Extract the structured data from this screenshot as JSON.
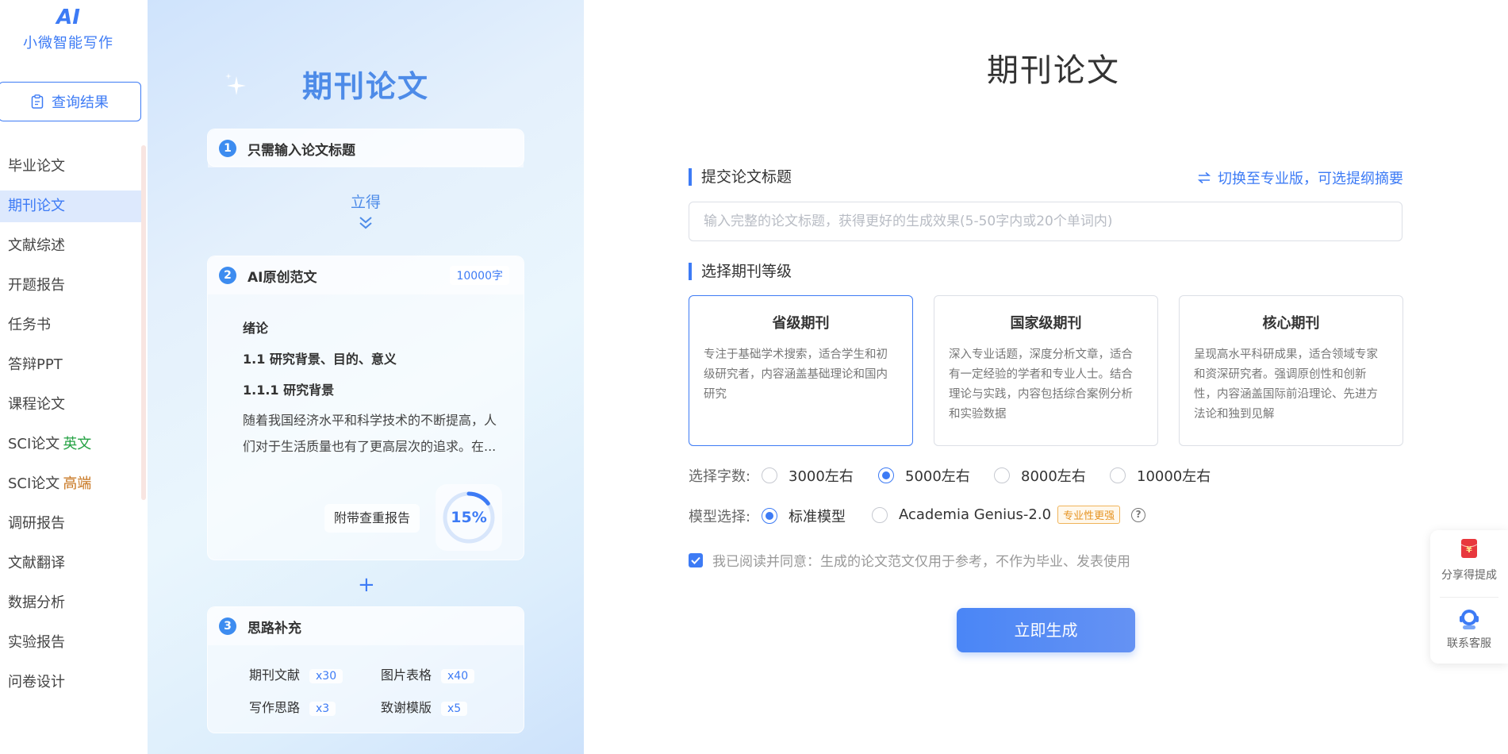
{
  "sidebar": {
    "logo_mark": "AI",
    "logo_text": "小微智能写作",
    "query_button": "查询结果",
    "nav": [
      {
        "label": "毕业论文"
      },
      {
        "label": "期刊论文",
        "active": true
      },
      {
        "label": "文献综述"
      },
      {
        "label": "开题报告"
      },
      {
        "label": "任务书"
      },
      {
        "label": "答辩PPT"
      },
      {
        "label": "课程论文"
      },
      {
        "label": "SCI论文",
        "tag": "英文"
      },
      {
        "label": "SCI论文",
        "tag": "高端"
      },
      {
        "label": "调研报告"
      },
      {
        "label": "文献翻译"
      },
      {
        "label": "数据分析"
      },
      {
        "label": "实验报告"
      },
      {
        "label": "问卷设计"
      }
    ]
  },
  "promo": {
    "title": "期刊论文",
    "step1": {
      "num": "1",
      "title": "只需输入论文标题"
    },
    "arrow_text": "立得",
    "step2": {
      "num": "2",
      "title": "AI原创范文",
      "badge": "10000字",
      "outline": [
        "绪论",
        "1.1 研究背景、目的、意义",
        "1.1.1 研究背景"
      ],
      "paragraph": "随着我国经济水平和科学技术的不断提高，人们对于生活质量也有了更高层次的追求。在...",
      "report_label": "附带查重报告",
      "progress_text": "15%",
      "progress": 0.15
    },
    "plus": "+",
    "step3": {
      "num": "3",
      "title": "思路补充",
      "items": [
        {
          "label": "期刊文献",
          "count": "x30"
        },
        {
          "label": "图片表格",
          "count": "x40"
        },
        {
          "label": "写作思路",
          "count": "x3"
        },
        {
          "label": "致谢模版",
          "count": "x5"
        }
      ]
    }
  },
  "form": {
    "title": "期刊论文",
    "title_section": "提交论文标题",
    "switch_link": "切换至专业版，可选提纲摘要",
    "title_placeholder": "输入完整的论文标题，获得更好的生成效果(5-50字内或20个单词内)",
    "level_section": "选择期刊等级",
    "levels": [
      {
        "name": "省级期刊",
        "desc": "专注于基础学术搜索，适合学生和初级研究者，内容涵盖基础理论和国内研究",
        "selected": true
      },
      {
        "name": "国家级期刊",
        "desc": "深入专业话题，深度分析文章，适合有一定经验的学者和专业人士。结合理论与实践，内容包括综合案例分析和实验数据"
      },
      {
        "name": "核心期刊",
        "desc": "呈现高水平科研成果，适合领域专家和资深研究者。强调原创性和创新性，内容涵盖国际前沿理论、先进方法论和独到见解"
      }
    ],
    "words_label": "选择字数:",
    "word_options": [
      {
        "label": "3000左右"
      },
      {
        "label": "5000左右",
        "selected": true
      },
      {
        "label": "8000左右"
      },
      {
        "label": "10000左右"
      }
    ],
    "model_label": "模型选择:",
    "model_options": [
      {
        "label": "标准模型",
        "selected": true
      },
      {
        "label": "Academia Genius-2.0"
      }
    ],
    "model_tag": "专业性更强",
    "help_icon": "?",
    "agree_text": "我已阅读并同意：生成的论文范文仅用于参考，不作为毕业、发表使用",
    "generate_button": "立即生成"
  },
  "float": {
    "share_label": "分享得提成",
    "envelope_text": "¥",
    "service_label": "联系客服"
  },
  "colors": {
    "accent": "#3d7bf5",
    "tag_en": "#25a244",
    "tag_pro": "#c7741d",
    "model_tag": "#e69423"
  }
}
